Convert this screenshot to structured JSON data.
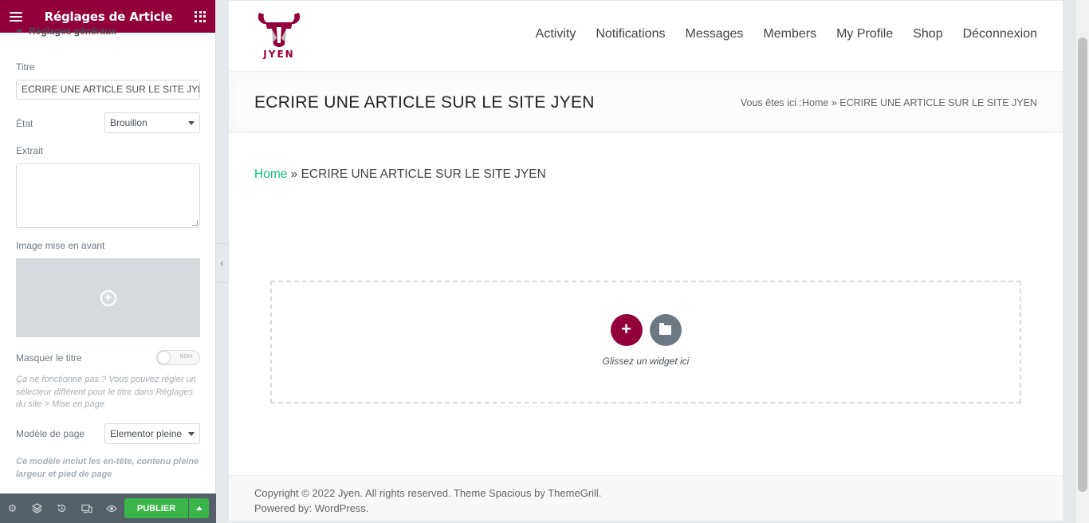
{
  "panel": {
    "header_title": "Réglages de Article",
    "section_title": "Réglages généraux",
    "title_label": "Titre",
    "title_value": "ECRIRE UNE ARTICLE SUR LE SITE JYEN",
    "status_label": "État",
    "status_value": "Brouillon",
    "excerpt_label": "Extrait",
    "featured_image_label": "Image mise en avant",
    "hide_title_label": "Masquer le titre",
    "hide_title_toggle": "NON",
    "hide_title_note": "Ça ne fonctionne pas ? Vous pouvez régler un sélecteur différent pour le titre dans Réglages du site > Mise en page",
    "template_label": "Modèle de page",
    "template_value": "Elementor pleine",
    "template_note": "Ce modèle inclut les en-tête, contenu pleine largeur et pied de page",
    "publish_label": "Publier"
  },
  "site": {
    "logo_text": "JYEN",
    "nav": [
      "Activity",
      "Notifications",
      "Messages",
      "Members",
      "My Profile",
      "Shop",
      "Déconnexion"
    ],
    "page_title": "ECRIRE UNE ARTICLE SUR LE SITE JYEN",
    "breadcrumb_prefix": "Vous êtes ici :",
    "breadcrumb_home": "Home",
    "breadcrumb_sep": " » ",
    "breadcrumb_current": "ECRIRE UNE ARTICLE SUR LE SITE JYEN",
    "drop_text": "Glissez un widget ici",
    "footer_line1": "Copyright © 2022 Jyen. All rights reserved. Theme Spacious by ThemeGrill.",
    "footer_line2": "Powered by: WordPress."
  },
  "colors": {
    "brand": "#92003b",
    "publish": "#39b54a",
    "link_green": "#0fbe7c"
  }
}
